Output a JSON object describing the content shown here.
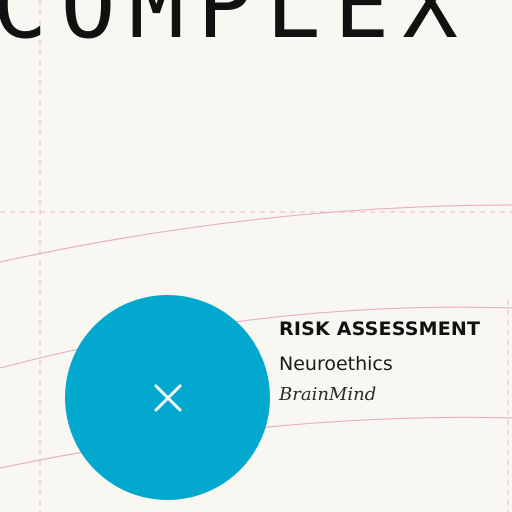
{
  "headline": {
    "text": "COMPLEX"
  },
  "card": {
    "title": "RISK ASSESSMENT",
    "subtitle": "Neuroethics",
    "brand": "BrainMind"
  },
  "icons": {
    "close": "close-icon"
  },
  "colors": {
    "background": "#f8f7f1",
    "accent": "#03a8cf",
    "guide_line": "#e7a9bd",
    "text": "#111111"
  }
}
